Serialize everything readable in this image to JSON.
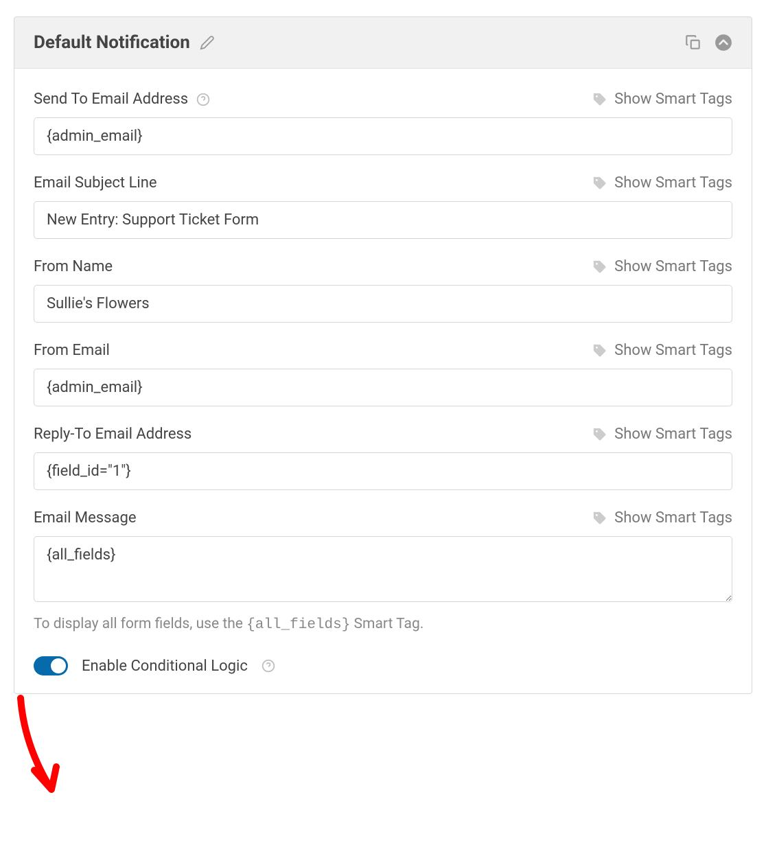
{
  "header": {
    "title": "Default Notification"
  },
  "smart_tags_label": "Show Smart Tags",
  "fields": {
    "send_to": {
      "label": "Send To Email Address",
      "value": "{admin_email}",
      "has_help": true
    },
    "subject": {
      "label": "Email Subject Line",
      "value": "New Entry: Support Ticket Form"
    },
    "from_name": {
      "label": "From Name",
      "value": "Sullie's Flowers"
    },
    "from_email": {
      "label": "From Email",
      "value": "{admin_email}"
    },
    "reply_to": {
      "label": "Reply-To Email Address",
      "value": "{field_id=\"1\"}"
    },
    "message": {
      "label": "Email Message",
      "value": "{all_fields}",
      "hint_prefix": "To display all form fields, use the ",
      "hint_code": "{all_fields}",
      "hint_suffix": " Smart Tag."
    }
  },
  "toggle": {
    "label": "Enable Conditional Logic",
    "enabled": true
  }
}
